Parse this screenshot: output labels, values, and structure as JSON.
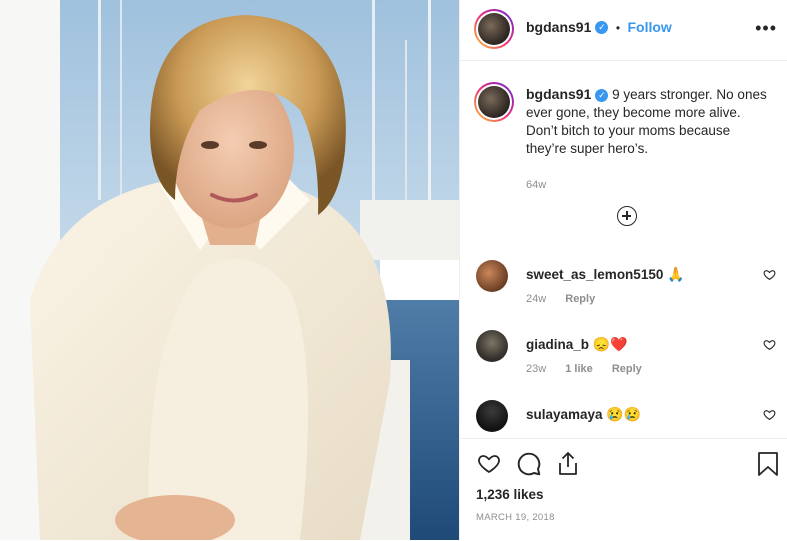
{
  "post": {
    "username": "bgdans91",
    "verified_mark": "✓",
    "follow_label": "Follow",
    "separator": "•",
    "more_label": "•••",
    "caption": "9 years stronger. No ones ever gone, they become more alive. Don’t bitch to your moms because they’re super hero’s.",
    "caption_age": "64w",
    "likes": "1,236 likes",
    "date": "MARCH 19, 2018"
  },
  "comments": [
    {
      "username": "sweet_as_lemon5150",
      "emoji": "🙏",
      "age": "24w",
      "likes": "",
      "reply": "Reply"
    },
    {
      "username": "giadina_b",
      "emoji": "😞❤️",
      "age": "23w",
      "likes": "1 like",
      "reply": "Reply"
    },
    {
      "username": "sulayamaya",
      "emoji": "😢😢",
      "age": "",
      "likes": "",
      "reply": ""
    }
  ],
  "icons": {
    "like": "heart-icon",
    "comment": "comment-icon",
    "share": "share-icon",
    "save": "bookmark-icon",
    "add": "plus-circle-icon",
    "comment_like": "heart-icon"
  },
  "colors": {
    "accent": "#3897f0",
    "muted": "#8e8e8e",
    "text": "#262626"
  }
}
